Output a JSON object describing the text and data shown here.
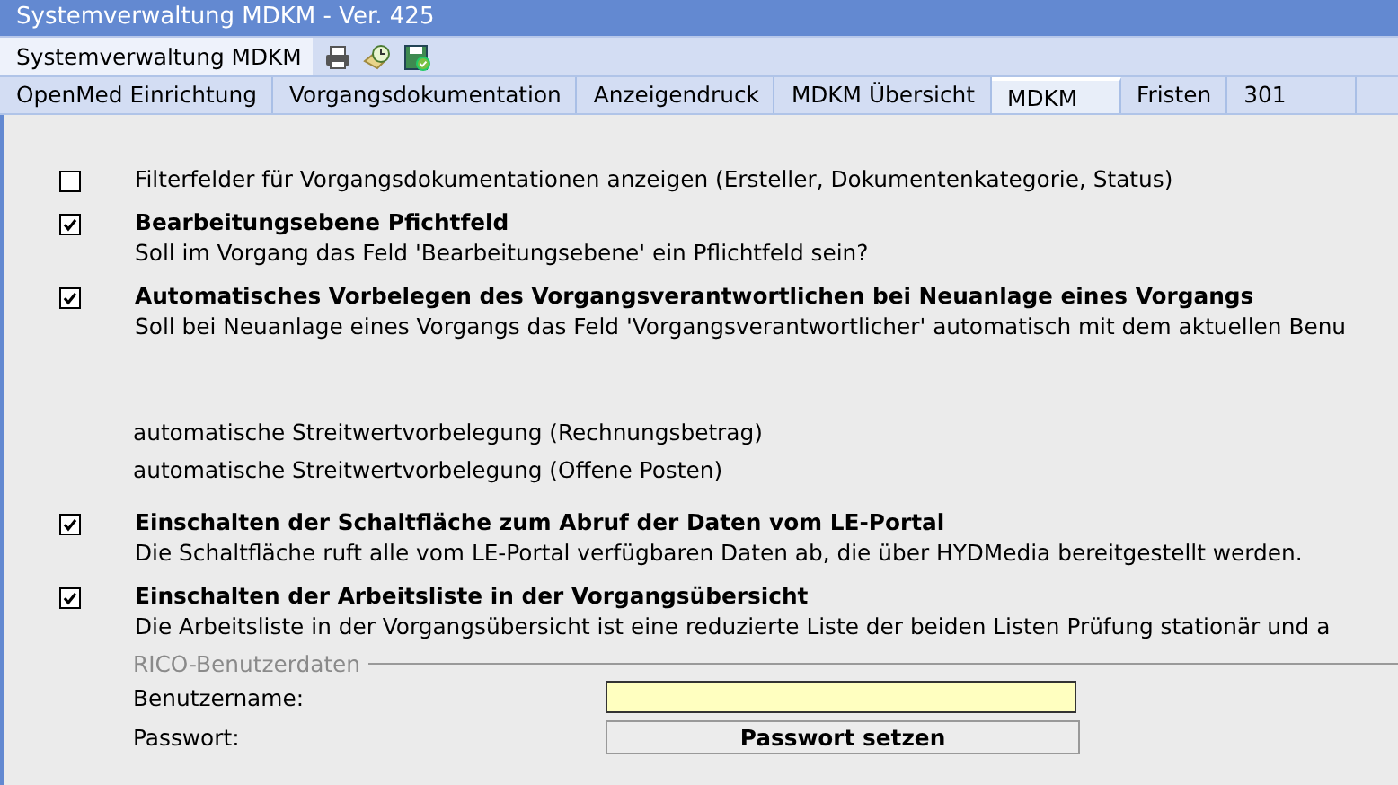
{
  "window": {
    "title": "Systemverwaltung MDKM - Ver. 425"
  },
  "toolbar": {
    "label": "Systemverwaltung MDKM",
    "icons": [
      {
        "kind": "printer"
      },
      {
        "kind": "clock"
      },
      {
        "kind": "save"
      }
    ]
  },
  "tabs": [
    {
      "label": "OpenMed Einrichtung",
      "selected": false
    },
    {
      "label": "Vorgangsdokumentation",
      "selected": false
    },
    {
      "label": "Anzeigendruck",
      "selected": false
    },
    {
      "label": "MDKM Übersicht",
      "selected": false
    },
    {
      "label": "MDKM",
      "selected": true
    },
    {
      "label": "Fristen",
      "selected": false
    },
    {
      "label": "301",
      "selected": false
    }
  ],
  "options": [
    {
      "kind": "checkbox",
      "checked": false,
      "label": "Filterfelder für Vorgangsdokumentationen anzeigen (Ersteller, Dokumentenkategorie, Status)"
    },
    {
      "kind": "checkbox",
      "checked": true,
      "title": "Bearbeitungsebene Pfichtfeld",
      "description": "Soll im Vorgang das Feld 'Bearbeitungsebene' ein Pflichtfeld sein?"
    },
    {
      "kind": "checkbox",
      "checked": true,
      "title": "Automatisches Vorbelegen des Vorgangsverantwortlichen bei Neuanlage eines Vorgangs",
      "description": "Soll bei Neuanlage eines Vorgangs das Feld 'Vorgangsverantwortlicher' automatisch mit dem aktuellen Benu"
    },
    {
      "kind": "spacer"
    },
    {
      "kind": "text",
      "label": "automatische Streitwertvorbelegung (Rechnungsbetrag)"
    },
    {
      "kind": "text",
      "label": "automatische Streitwertvorbelegung (Offene Posten)"
    },
    {
      "kind": "checkbox",
      "checked": true,
      "title": "Einschalten der Schaltfläche zum Abruf der Daten vom LE-Portal",
      "description": "Die Schaltfläche ruft alle vom LE-Portal verfügbaren Daten ab, die über HYDMedia bereitgestellt werden."
    },
    {
      "kind": "checkbox",
      "checked": true,
      "title": "Einschalten der Arbeitsliste in der Vorgangsübersicht",
      "description": "Die Arbeitsliste in der Vorgangsübersicht ist eine reduzierte Liste der beiden Listen Prüfung stationär und a"
    }
  ],
  "rico": {
    "legend": "RICO-Benutzerdaten",
    "username_label": "Benutzername:",
    "password_label": "Passwort:",
    "password_button": "Passwort setzen"
  }
}
